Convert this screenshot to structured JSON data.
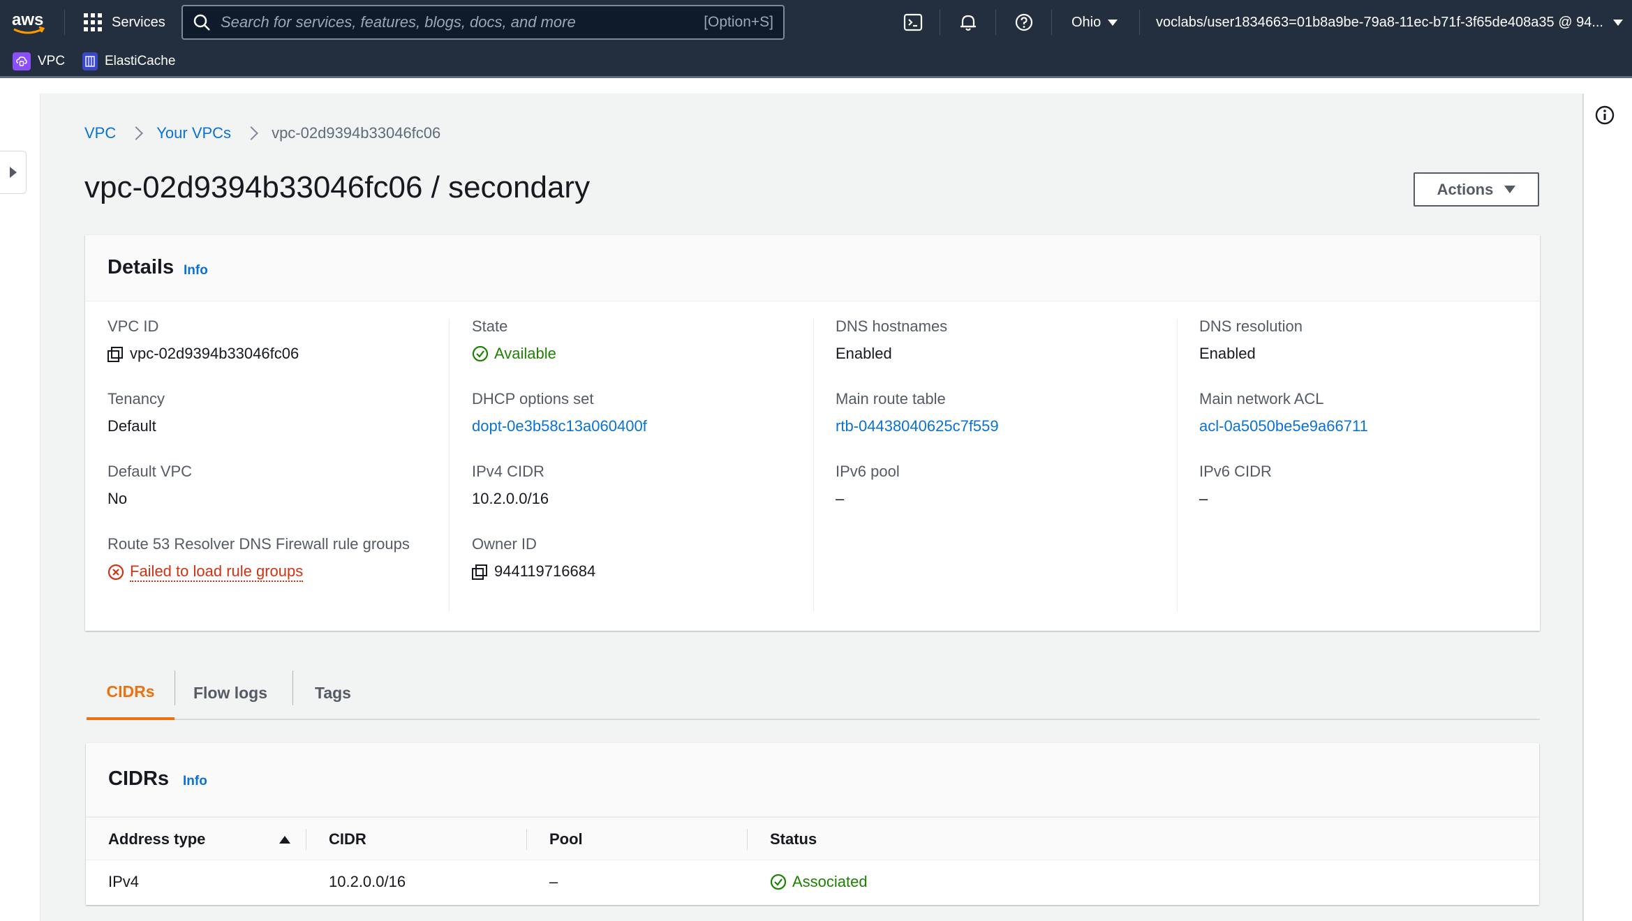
{
  "topnav": {
    "logo_text": "aws",
    "services_label": "Services",
    "search_placeholder": "Search for services, features, blogs, docs, and more",
    "search_shortcut": "[Option+S]",
    "region": "Ohio",
    "account": "voclabs/user1834663=01b8a9be-79a8-11ec-b71f-3f65de408a35 @ 94..."
  },
  "favorites": [
    {
      "label": "VPC",
      "icon": "vpc-icon",
      "color": "#8c4fff"
    },
    {
      "label": "ElastiCache",
      "icon": "elasticache-icon",
      "color": "#3b48cc"
    }
  ],
  "breadcrumb": {
    "items": [
      "VPC",
      "Your VPCs"
    ],
    "current": "vpc-02d9394b33046fc06"
  },
  "page": {
    "title": "vpc-02d9394b33046fc06 / secondary",
    "actions_label": "Actions"
  },
  "details": {
    "title": "Details",
    "info": "Info",
    "col1": {
      "vpc_id_label": "VPC ID",
      "vpc_id_value": "vpc-02d9394b33046fc06",
      "tenancy_label": "Tenancy",
      "tenancy_value": "Default",
      "default_vpc_label": "Default VPC",
      "default_vpc_value": "No",
      "route53_label": "Route 53 Resolver DNS Firewall rule groups",
      "route53_value": "Failed to load rule groups"
    },
    "col2": {
      "state_label": "State",
      "state_value": "Available",
      "dhcp_label": "DHCP options set",
      "dhcp_value": "dopt-0e3b58c13a060400f",
      "ipv4_label": "IPv4 CIDR",
      "ipv4_value": "10.2.0.0/16",
      "owner_label": "Owner ID",
      "owner_value": "944119716684"
    },
    "col3": {
      "dns_hostnames_label": "DNS hostnames",
      "dns_hostnames_value": "Enabled",
      "route_table_label": "Main route table",
      "route_table_value": "rtb-04438040625c7f559",
      "ipv6_pool_label": "IPv6 pool",
      "ipv6_pool_value": "–"
    },
    "col4": {
      "dns_resolution_label": "DNS resolution",
      "dns_resolution_value": "Enabled",
      "acl_label": "Main network ACL",
      "acl_value": "acl-0a5050be5e9a66711",
      "ipv6_cidr_label": "IPv6 CIDR",
      "ipv6_cidr_value": "–"
    }
  },
  "tabs": [
    "CIDRs",
    "Flow logs",
    "Tags"
  ],
  "cidrs": {
    "title": "CIDRs",
    "info": "Info",
    "columns": [
      "Address type",
      "CIDR",
      "Pool",
      "Status"
    ],
    "rows": [
      {
        "address_type": "IPv4",
        "cidr": "10.2.0.0/16",
        "pool": "–",
        "status": "Associated"
      }
    ]
  },
  "colors": {
    "nav_bg": "#232f3e",
    "link": "#0972d3",
    "success": "#1d8102",
    "error": "#d13212",
    "tab_active": "#ec7211"
  }
}
